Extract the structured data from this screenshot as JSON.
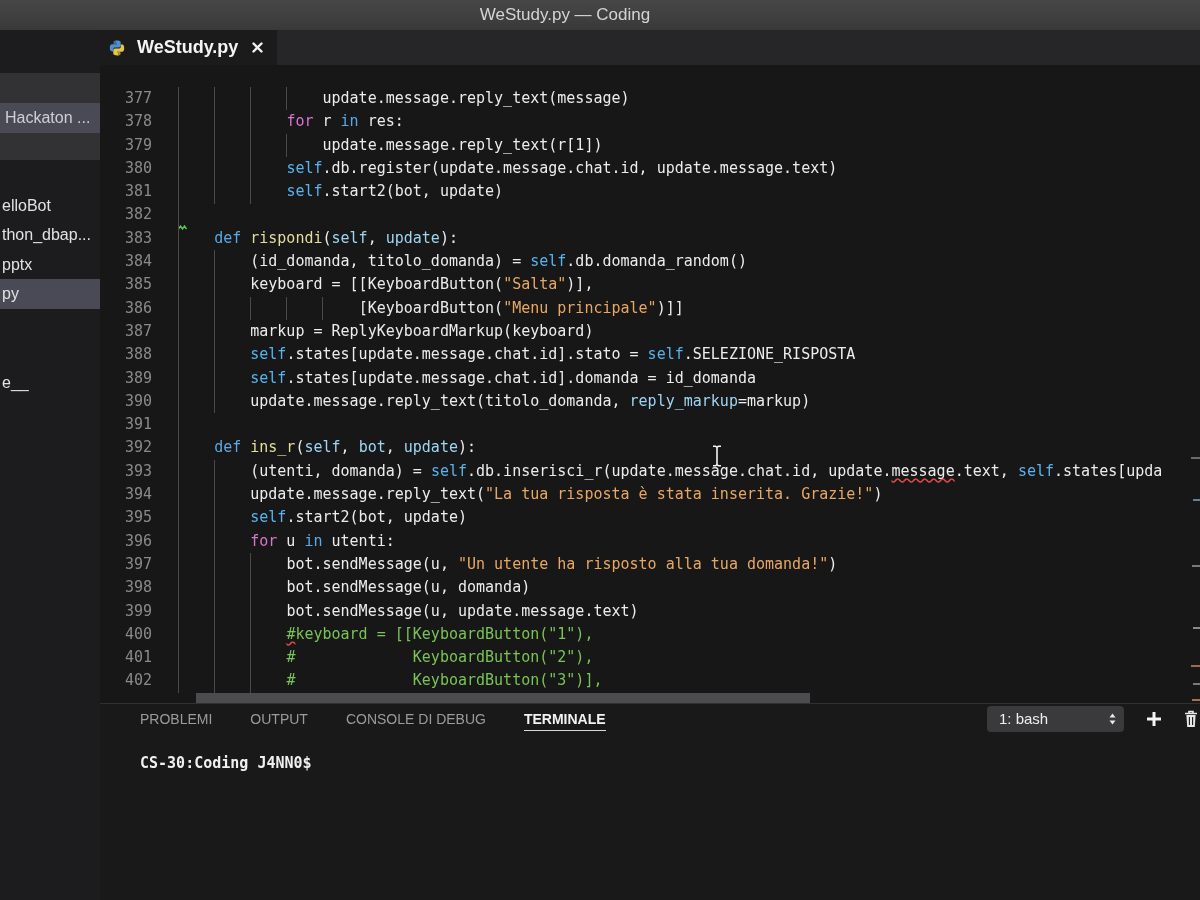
{
  "window": {
    "title": "WeStudy.py — Coding"
  },
  "sidebar": {
    "open_editors": [
      {
        "label": "Hackaton ...",
        "selected": true
      }
    ],
    "files": [
      {
        "label": "elloBot",
        "selected": false
      },
      {
        "label": "thon_dbap...",
        "selected": false
      },
      {
        "label": "pptx",
        "selected": false
      },
      {
        "label": "py",
        "selected": true
      },
      {
        "selected": false
      },
      {
        "selected": false
      },
      {
        "label": "e__",
        "selected": false
      }
    ]
  },
  "tabs": [
    {
      "label": "WeStudy.py",
      "selected": true
    }
  ],
  "editor": {
    "lines": [
      {
        "number": "377",
        "tokens": [
          {
            "text": "                update.message.reply_text(message)",
            "kind": "plain"
          }
        ]
      },
      {
        "number": "378",
        "tokens": [
          {
            "text": "            for",
            "kind": "control"
          },
          {
            "text": " r ",
            "kind": "plain"
          },
          {
            "text": "in",
            "kind": "keyword"
          },
          {
            "text": " res:",
            "kind": "plain"
          }
        ]
      },
      {
        "number": "379",
        "tokens": [
          {
            "text": "                update.message.reply_text(r[1])",
            "kind": "plain"
          }
        ]
      },
      {
        "number": "380",
        "tokens": [
          {
            "text": "            self",
            "kind": "self"
          },
          {
            "text": ".db.register(update.message.chat.id, update.message.text)",
            "kind": "plain"
          }
        ]
      },
      {
        "number": "381",
        "tokens": [
          {
            "text": "            self",
            "kind": "self"
          },
          {
            "text": ".start2(bot, update)",
            "kind": "plain"
          }
        ]
      },
      {
        "number": "382",
        "warning": true
      },
      {
        "number": "383",
        "tokens": [
          {
            "text": "    def",
            "kind": "keyword"
          },
          {
            "text": " rispondi",
            "kind": "function"
          },
          {
            "text": "(",
            "kind": "plain"
          },
          {
            "text": "self",
            "kind": "parameter"
          },
          {
            "text": ", ",
            "kind": "plain"
          },
          {
            "text": "update",
            "kind": "parameter"
          },
          {
            "text": "):",
            "kind": "plain"
          }
        ]
      },
      {
        "number": "384",
        "tokens": [
          {
            "text": "        (id_domanda, titolo_domanda) = ",
            "kind": "plain"
          },
          {
            "text": "self",
            "kind": "self"
          },
          {
            "text": ".db.domanda_random()",
            "kind": "plain"
          }
        ]
      },
      {
        "number": "385",
        "tokens": [
          {
            "text": "        keyboard = [[KeyboardButton(",
            "kind": "plain"
          },
          {
            "text": "\"Salta\"",
            "kind": "string"
          },
          {
            "text": ")],",
            "kind": "plain"
          }
        ]
      },
      {
        "number": "386",
        "tokens": [
          {
            "text": "                    [KeyboardButton(",
            "kind": "plain"
          },
          {
            "text": "\"Menu principale\"",
            "kind": "string"
          },
          {
            "text": ")]]",
            "kind": "plain"
          }
        ]
      },
      {
        "number": "387",
        "tokens": [
          {
            "text": "        markup = ReplyKeyboardMarkup(keyboard)",
            "kind": "plain"
          }
        ]
      },
      {
        "number": "388",
        "tokens": [
          {
            "text": "        self",
            "kind": "self"
          },
          {
            "text": ".states[update.message.chat.id].stato = ",
            "kind": "plain"
          },
          {
            "text": "self",
            "kind": "self"
          },
          {
            "text": ".SELEZIONE_RISPOSTA",
            "kind": "plain"
          }
        ]
      },
      {
        "number": "389",
        "tokens": [
          {
            "text": "        self",
            "kind": "self"
          },
          {
            "text": ".states[update.message.chat.id].domanda = id_domanda",
            "kind": "plain"
          }
        ]
      },
      {
        "number": "390",
        "tokens": [
          {
            "text": "        update.message.reply_text(titolo_domanda, ",
            "kind": "plain"
          },
          {
            "text": "reply_markup",
            "kind": "parameter"
          },
          {
            "text": "=markup)",
            "kind": "plain"
          }
        ]
      },
      {
        "number": "391"
      },
      {
        "number": "392",
        "tokens": [
          {
            "text": "    def",
            "kind": "keyword"
          },
          {
            "text": " ins_r",
            "kind": "function"
          },
          {
            "text": "(",
            "kind": "plain"
          },
          {
            "text": "self",
            "kind": "parameter"
          },
          {
            "text": ", ",
            "kind": "plain"
          },
          {
            "text": "bot",
            "kind": "parameter"
          },
          {
            "text": ", ",
            "kind": "plain"
          },
          {
            "text": "update",
            "kind": "parameter"
          },
          {
            "text": "):",
            "kind": "plain"
          }
        ]
      },
      {
        "number": "393",
        "tokens": [
          {
            "text": "        (utenti, domanda) = ",
            "kind": "plain"
          },
          {
            "text": "self",
            "kind": "self"
          },
          {
            "text": ".db.inserisci_r(update.message.chat.id, update.",
            "kind": "plain"
          },
          {
            "text": "message",
            "kind": "plain",
            "error": true
          },
          {
            "text": ".text, ",
            "kind": "plain"
          },
          {
            "text": "self",
            "kind": "self"
          },
          {
            "text": ".states[upda",
            "kind": "plain"
          }
        ]
      },
      {
        "number": "394",
        "tokens": [
          {
            "text": "        update.message.reply_text(",
            "kind": "plain"
          },
          {
            "text": "\"La tua risposta è stata inserita. Grazie!\"",
            "kind": "string"
          },
          {
            "text": ")",
            "kind": "plain"
          }
        ]
      },
      {
        "number": "395",
        "tokens": [
          {
            "text": "        self",
            "kind": "self"
          },
          {
            "text": ".start2(bot, update)",
            "kind": "plain"
          }
        ]
      },
      {
        "number": "396",
        "tokens": [
          {
            "text": "        for",
            "kind": "control"
          },
          {
            "text": " u ",
            "kind": "plain"
          },
          {
            "text": "in",
            "kind": "keyword"
          },
          {
            "text": " utenti:",
            "kind": "plain"
          }
        ]
      },
      {
        "number": "397",
        "tokens": [
          {
            "text": "            bot.sendMessage(u, ",
            "kind": "plain"
          },
          {
            "text": "\"Un utente ha risposto alla tua domanda!\"",
            "kind": "string"
          },
          {
            "text": ")",
            "kind": "plain"
          }
        ]
      },
      {
        "number": "398",
        "tokens": [
          {
            "text": "            bot.sendMessage(u, domanda)",
            "kind": "plain"
          }
        ]
      },
      {
        "number": "399",
        "tokens": [
          {
            "text": "            bot.sendMessage(u, update.message.text)",
            "kind": "plain"
          }
        ]
      },
      {
        "number": "400",
        "tokens": [
          {
            "text": "            #",
            "kind": "comment",
            "error": true
          },
          {
            "text": "keyboard = [[KeyboardButton(\"1\"),",
            "kind": "comment"
          }
        ]
      },
      {
        "number": "401",
        "tokens": [
          {
            "text": "            #             KeyboardButton(\"2\"),",
            "kind": "comment"
          }
        ]
      },
      {
        "number": "402",
        "tokens": [
          {
            "text": "            #             KeyboardButton(\"3\")],",
            "kind": "comment"
          }
        ]
      }
    ]
  },
  "panel": {
    "tabs": [
      {
        "label": "PROBLEMI",
        "selected": false
      },
      {
        "label": "OUTPUT",
        "selected": false
      },
      {
        "label": "CONSOLE DI DEBUG",
        "selected": false
      },
      {
        "label": "TERMINALE",
        "selected": true
      }
    ],
    "terminal_selector": "1: bash",
    "terminal_lines": [
      "CS-30:Coding J4NN0$"
    ]
  }
}
